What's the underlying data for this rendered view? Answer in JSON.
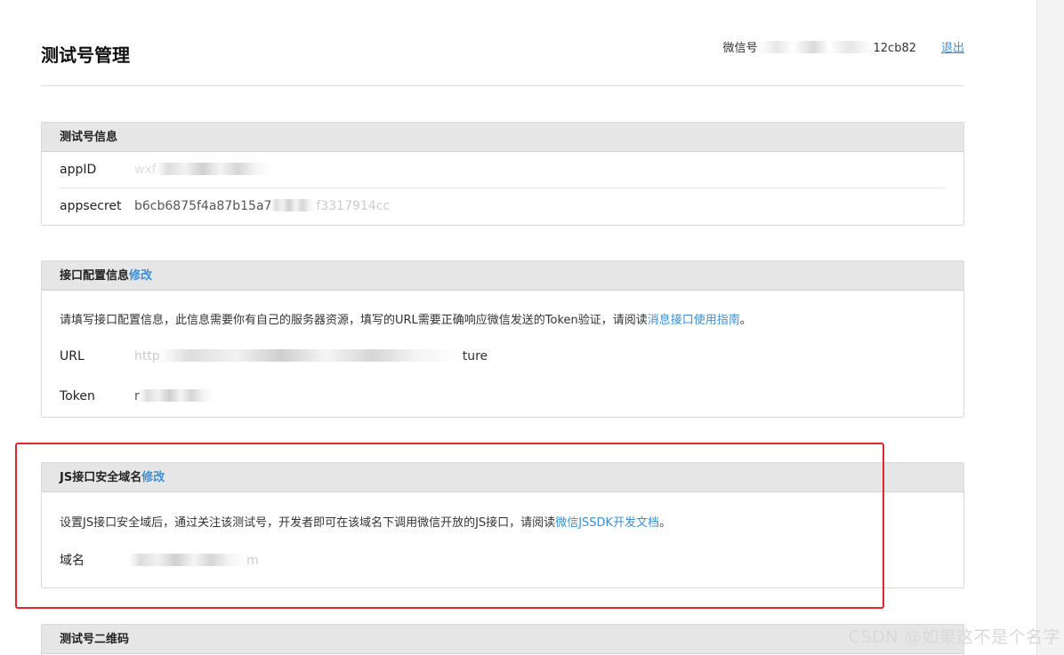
{
  "header": {
    "title": "测试号管理",
    "account_prefix": "微信号",
    "account_suffix": "12cb82",
    "logout_label": "退出"
  },
  "panel_info": {
    "heading": "测试号信息",
    "rows": [
      {
        "label": "appID",
        "value_visible": "wxf"
      },
      {
        "label": "appsecret",
        "value_visible": "b6cb6875f4a87b15a7",
        "value_tail": "f3317914cc"
      }
    ]
  },
  "panel_interface": {
    "heading": "接口配置信息",
    "edit_label": "修改",
    "desc_text": "请填写接口配置信息，此信息需要你有自己的服务器资源，填写的URL需要正确响应微信发送的Token验证，请阅读",
    "desc_link": "消息接口使用指南",
    "desc_end": "。",
    "rows": [
      {
        "label": "URL",
        "value_head": "http",
        "value_tail": "ture"
      },
      {
        "label": "Token",
        "value_head": "r"
      }
    ]
  },
  "panel_js": {
    "heading": "JS接口安全域名",
    "edit_label": "修改",
    "desc_text": "设置JS接口安全域后，通过关注该测试号，开发者即可在该域名下调用微信开放的JS接口，请阅读",
    "desc_link": "微信JSSDK开发文档",
    "desc_end": "。",
    "rows": [
      {
        "label": "域名",
        "value_tail": "m"
      }
    ]
  },
  "panel_qr": {
    "heading": "测试号二维码"
  },
  "watermark": "CSDN @如果这不是个名字",
  "colors": {
    "link": "#3a8fd9",
    "highlight_box": "#e0262e",
    "panel_header_bg": "#e6e6e6"
  }
}
